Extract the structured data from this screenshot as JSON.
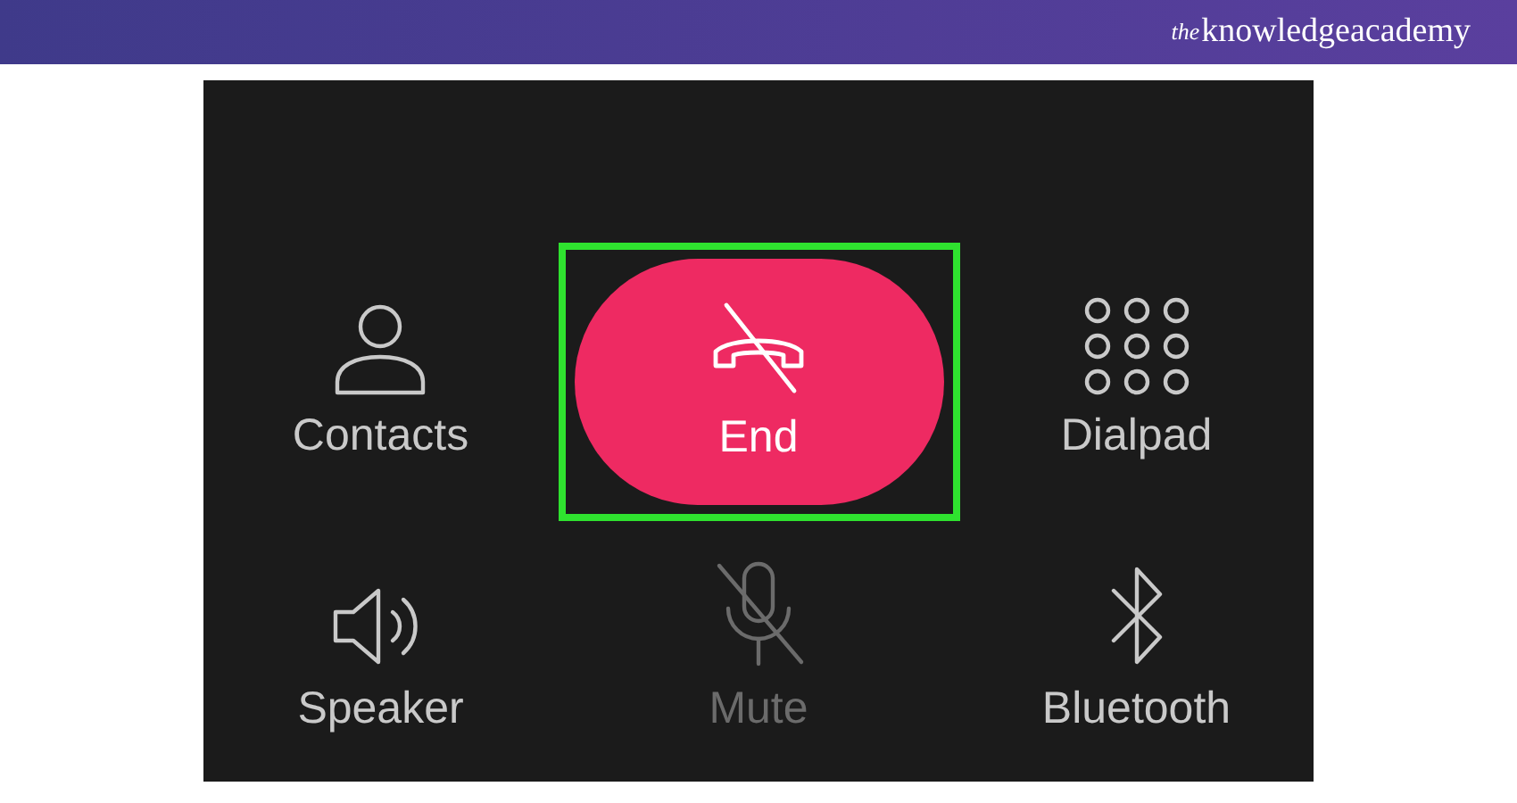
{
  "header": {
    "brand_prefix": "the",
    "brand": "knowledgeacademy"
  },
  "call_controls": [
    {
      "kind": "contacts",
      "label": "Contacts",
      "disabled": false,
      "highlighted": false
    },
    {
      "kind": "end",
      "label": "End",
      "disabled": false,
      "highlighted": true
    },
    {
      "kind": "dialpad",
      "label": "Dialpad",
      "disabled": false,
      "highlighted": false
    },
    {
      "kind": "speaker",
      "label": "Speaker",
      "disabled": false,
      "highlighted": false
    },
    {
      "kind": "mute",
      "label": "Mute",
      "disabled": true,
      "highlighted": false
    },
    {
      "kind": "bluetooth",
      "label": "Bluetooth",
      "disabled": false,
      "highlighted": false
    }
  ]
}
